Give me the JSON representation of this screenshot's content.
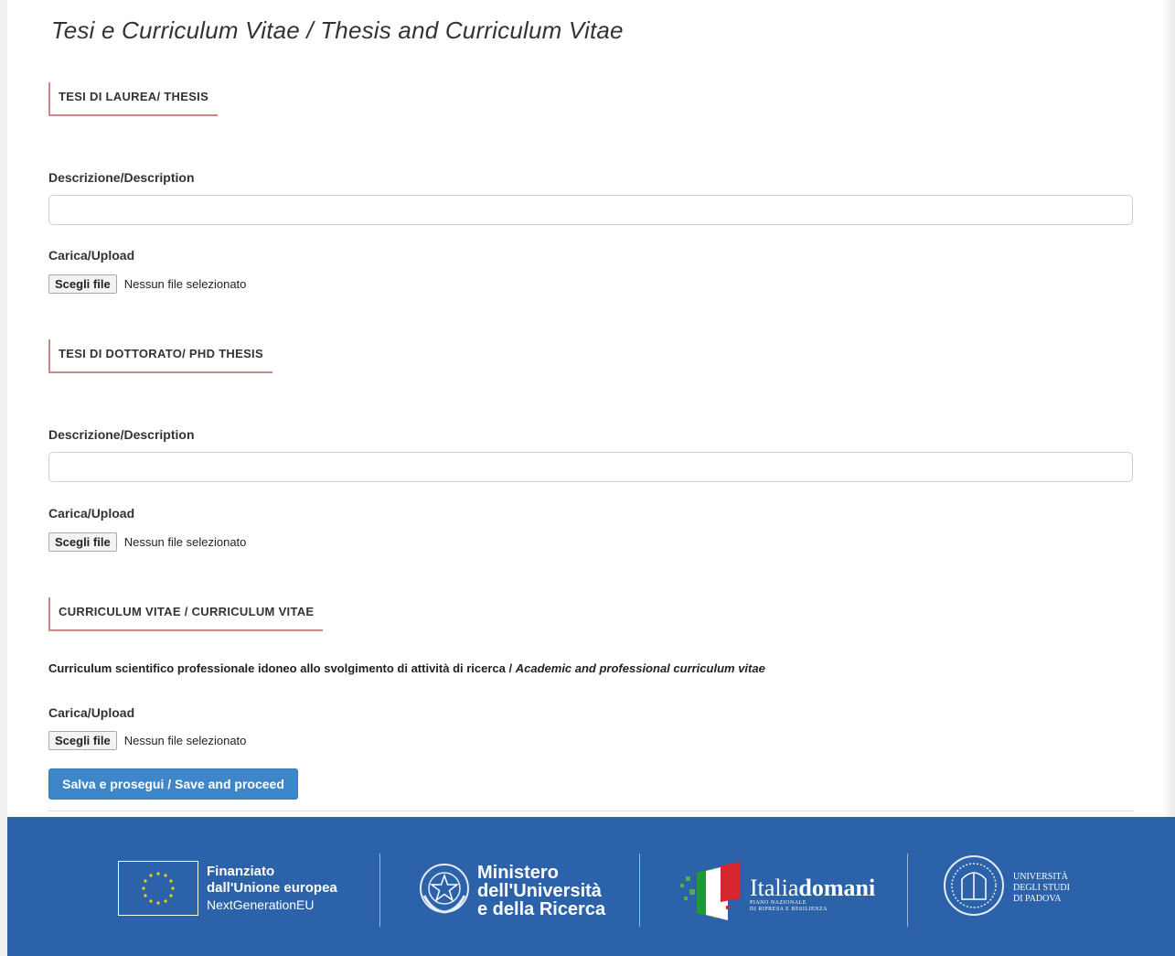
{
  "page_title": "Tesi e Curriculum Vitae / Thesis and Curriculum Vitae",
  "sections": [
    {
      "heading": "TESI DI LAUREA/ THESIS",
      "description_label": "Descrizione/Description",
      "description_value": "",
      "upload_label": "Carica/Upload",
      "file_button": "Scegli file",
      "file_status": "Nessun file selezionato"
    },
    {
      "heading": "TESI DI DOTTORATO/ PHD THESIS",
      "description_label": "Descrizione/Description",
      "description_value": "",
      "upload_label": "Carica/Upload",
      "file_button": "Scegli file",
      "file_status": "Nessun file selezionato"
    },
    {
      "heading": "CURRICULUM VITAE / CURRICULUM VITAE",
      "text_it": "Curriculum scientifico professionale idoneo allo svolgimento di attività di ricerca / ",
      "text_en": "Academic and professional curriculum vitae",
      "upload_label": "Carica/Upload",
      "file_button": "Scegli file",
      "file_status": "Nessun file selezionato"
    }
  ],
  "submit_button": "Salva e prosegui / Save and proceed",
  "footer": {
    "eu": {
      "line1": "Finanziato",
      "line2": "dall'Unione europea",
      "line3": "NextGenerationEU"
    },
    "mur": {
      "line1": "Ministero",
      "line2": "dell'Università",
      "line3": "e della Ricerca"
    },
    "italiadomani": {
      "light": "Italia",
      "bold": "domani",
      "sub1": "PIANO NAZIONALE",
      "sub2": "DI RIPRESA E RESILIENZA"
    },
    "unipd": {
      "line1": "UNIVERSITÀ",
      "line2": "DEGLI STUDI",
      "line3": "DI PADOVA"
    }
  },
  "colors": {
    "accent_button": "#3f86c8",
    "footer_bg": "#2b62a9",
    "heading_underline": "#c68a8a"
  }
}
